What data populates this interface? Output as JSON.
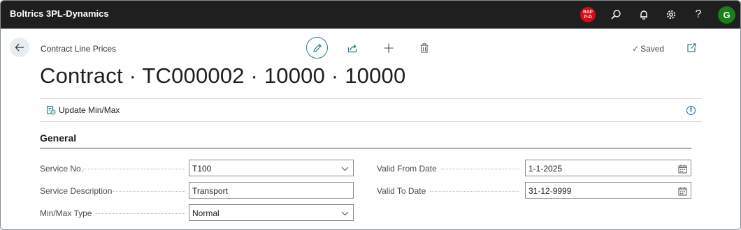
{
  "topbar": {
    "app_title": "Boltrics 3PL-Dynamics",
    "env_badge_line1": "RAP",
    "env_badge_line2": "P-D",
    "avatar_initial": "G",
    "icons": [
      "search-icon",
      "bell-icon",
      "gear-icon",
      "help-icon"
    ]
  },
  "header": {
    "caption": "Contract Line Prices",
    "title": "Contract · TC000002 · 10000 · 10000",
    "saved_label": "Saved",
    "actions": [
      "edit-icon",
      "share-icon",
      "add-icon",
      "delete-icon"
    ]
  },
  "actionbar": {
    "update_label": "Update Min/Max"
  },
  "general": {
    "section_title": "General",
    "service_no": {
      "label": "Service No.",
      "value": "T100"
    },
    "service_description": {
      "label": "Service Description",
      "value": "Transport"
    },
    "min_max_type": {
      "label": "Min/Max Type",
      "value": "Normal"
    },
    "valid_from_date": {
      "label": "Valid From Date",
      "value": "1-1-2025"
    },
    "valid_to_date": {
      "label": "Valid To Date",
      "value": "31-12-9999"
    }
  },
  "colors": {
    "topbar": "#1f1f1f",
    "accent": "#2a7f86",
    "badge": "#d50c14",
    "avatar": "#1a7f1a"
  }
}
